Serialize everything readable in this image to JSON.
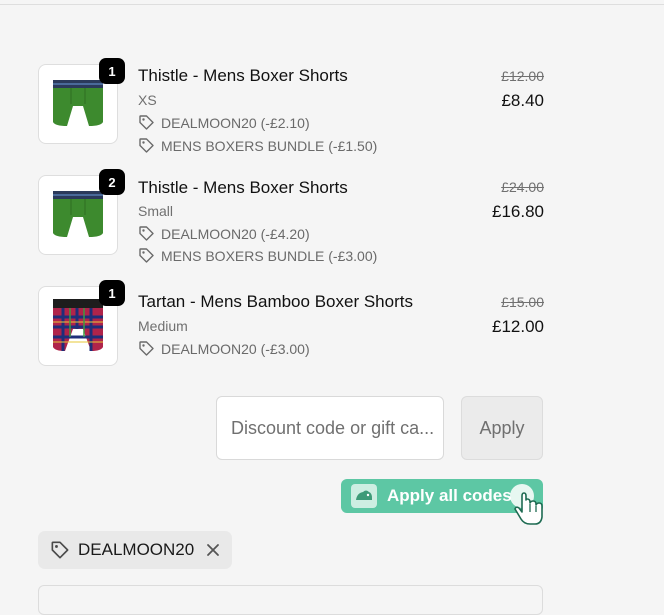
{
  "items": [
    {
      "quantity": "1",
      "name": "Thistle - Mens Boxer Shorts",
      "variant": "XS",
      "discounts": [
        "DEALMOON20 (-£2.10)",
        "MENS BOXERS BUNDLE (-£1.50)"
      ],
      "original_price": "£12.00",
      "price": "£8.40",
      "image": "green-boxer-shorts-icon"
    },
    {
      "quantity": "2",
      "name": "Thistle - Mens Boxer Shorts",
      "variant": "Small",
      "discounts": [
        "DEALMOON20 (-£4.20)",
        "MENS BOXERS BUNDLE (-£3.00)"
      ],
      "original_price": "£24.00",
      "price": "£16.80",
      "image": "green-boxer-shorts-icon"
    },
    {
      "quantity": "1",
      "name": "Tartan - Mens Bamboo Boxer Shorts",
      "variant": "Medium",
      "discounts": [
        "DEALMOON20 (-£3.00)"
      ],
      "original_price": "£15.00",
      "price": "£12.00",
      "image": "tartan-boxer-shorts-icon"
    }
  ],
  "discount": {
    "placeholder": "Discount code or gift ca...",
    "apply_label": "Apply",
    "apply_all_label": "Apply all codes"
  },
  "applied_code": {
    "label": "DEALMOON20"
  },
  "colors": {
    "accent": "#5dc7a4",
    "background": "#f5f5f5",
    "badge": "#000000"
  }
}
